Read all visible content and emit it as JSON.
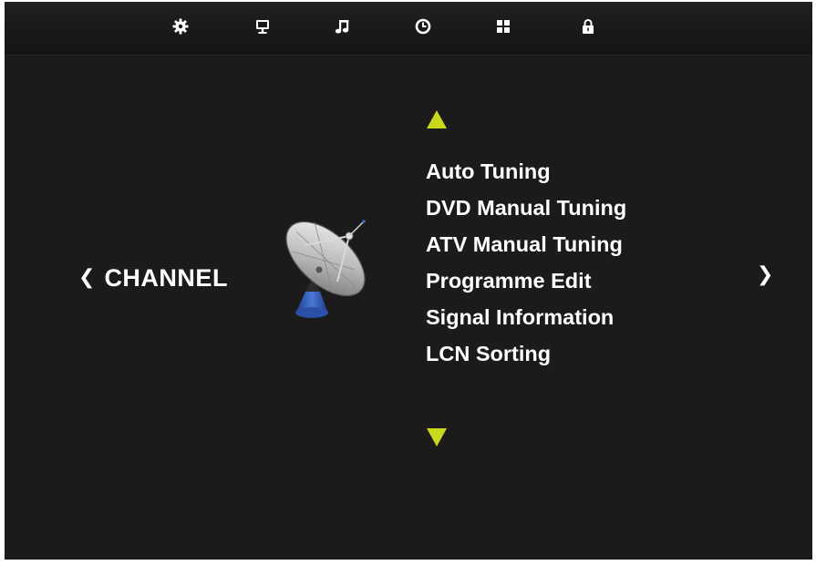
{
  "tabs": [
    {
      "icon": "gear-icon"
    },
    {
      "icon": "monitor-icon"
    },
    {
      "icon": "music-note-icon"
    },
    {
      "icon": "clock-icon"
    },
    {
      "icon": "grid-icon"
    },
    {
      "icon": "lock-icon"
    }
  ],
  "channel": {
    "title": "CHANNEL",
    "prev_glyph": "❮",
    "next_glyph": "❯",
    "illustration": "satellite-dish-icon"
  },
  "menu": {
    "items": [
      {
        "label": "Auto Tuning"
      },
      {
        "label": "DVD Manual Tuning"
      },
      {
        "label": "ATV Manual Tuning"
      },
      {
        "label": "Programme Edit"
      },
      {
        "label": "Signal Information"
      },
      {
        "label": "LCN Sorting"
      }
    ],
    "scroll_up_icon": "arrow-up-icon",
    "scroll_down_icon": "arrow-down-icon"
  },
  "colors": {
    "background": "#1b1b1b",
    "topbar": "#171717",
    "text": "#ffffff",
    "accent": "#c9d81c",
    "dish_base": "#3a63c4"
  }
}
